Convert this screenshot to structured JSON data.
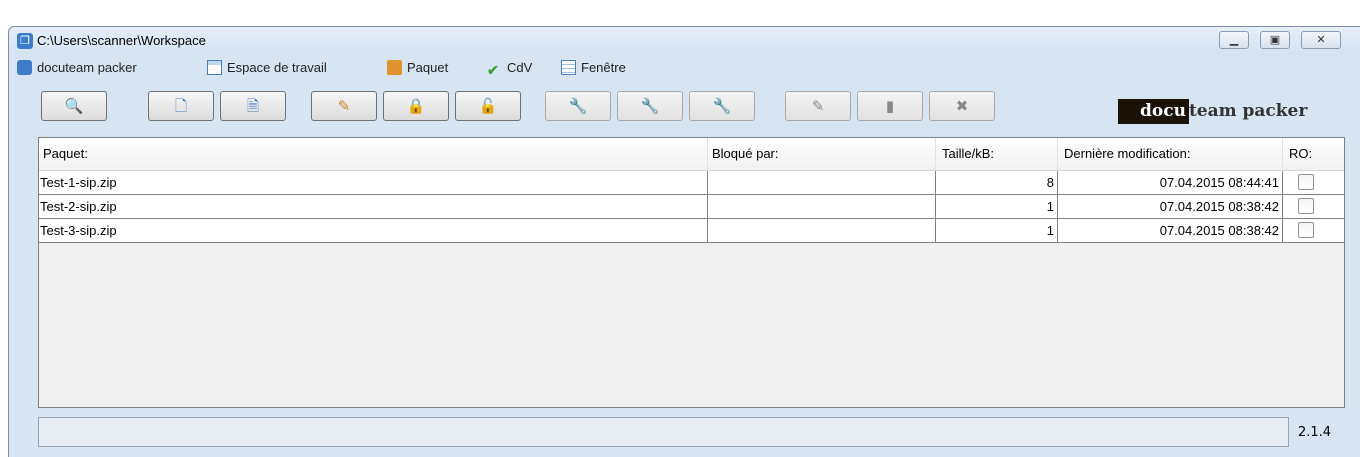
{
  "window": {
    "title": "C:\\Users\\scanner\\Workspace",
    "controls": [
      "minimize-icon",
      "maximize-icon",
      "close-icon"
    ]
  },
  "menu": [
    {
      "label": "docuteam packer",
      "icon": "app-cube-icon"
    },
    {
      "label": "Espace de travail",
      "icon": "workspace-window-icon"
    },
    {
      "label": "Paquet",
      "icon": "package-box-icon"
    },
    {
      "label": "CdV",
      "icon": "checkmark-icon"
    },
    {
      "label": "Fenêtre",
      "icon": "window-list-icon"
    }
  ],
  "toolbar": {
    "buttons": [
      {
        "name": "search-button",
        "icon": "magnifier-icon",
        "enabled": true
      },
      {
        "name": "new-button",
        "icon": "blank-document-icon",
        "enabled": true
      },
      {
        "name": "open-button",
        "icon": "document-lines-icon",
        "enabled": true
      },
      {
        "name": "edit-package-button",
        "icon": "package-edit-icon",
        "enabled": true
      },
      {
        "name": "lock-package-button",
        "icon": "package-lock-icon",
        "enabled": true
      },
      {
        "name": "unlock-package-button",
        "icon": "package-unlock-icon",
        "enabled": true
      },
      {
        "name": "tool-button",
        "icon": "wrench-icon",
        "enabled": false
      },
      {
        "name": "tool-2-button",
        "icon": "wrench-2-icon",
        "enabled": false
      },
      {
        "name": "tool-3-button",
        "icon": "wrench-3-icon",
        "enabled": false
      },
      {
        "name": "rename-button",
        "icon": "pencil-icon",
        "enabled": false
      },
      {
        "name": "copy-button",
        "icon": "copy-document-icon",
        "enabled": false
      },
      {
        "name": "delete-button",
        "icon": "x-icon",
        "enabled": false
      }
    ]
  },
  "brand": {
    "dark": "docu",
    "light": "team packer"
  },
  "table": {
    "headers": [
      "Paquet:",
      "Bloqué par:",
      "Taille/kB:",
      "Dernière modification:",
      "RO:"
    ],
    "rows": [
      {
        "package": "Test-1-sip.zip",
        "locked_by": "",
        "size": "8",
        "modified": "07.04.2015 08:44:41",
        "ro": false
      },
      {
        "package": "Test-2-sip.zip",
        "locked_by": "",
        "size": "1",
        "modified": "07.04.2015 08:38:42",
        "ro": false
      },
      {
        "package": "Test-3-sip.zip",
        "locked_by": "",
        "size": "1",
        "modified": "07.04.2015 08:38:42",
        "ro": false
      }
    ]
  },
  "status": {
    "text": "",
    "version": "2.1.4"
  },
  "colors": {
    "frame": "#d7e4f2",
    "brand_dark": "#1c1208",
    "accent": "#3d7cc9"
  }
}
